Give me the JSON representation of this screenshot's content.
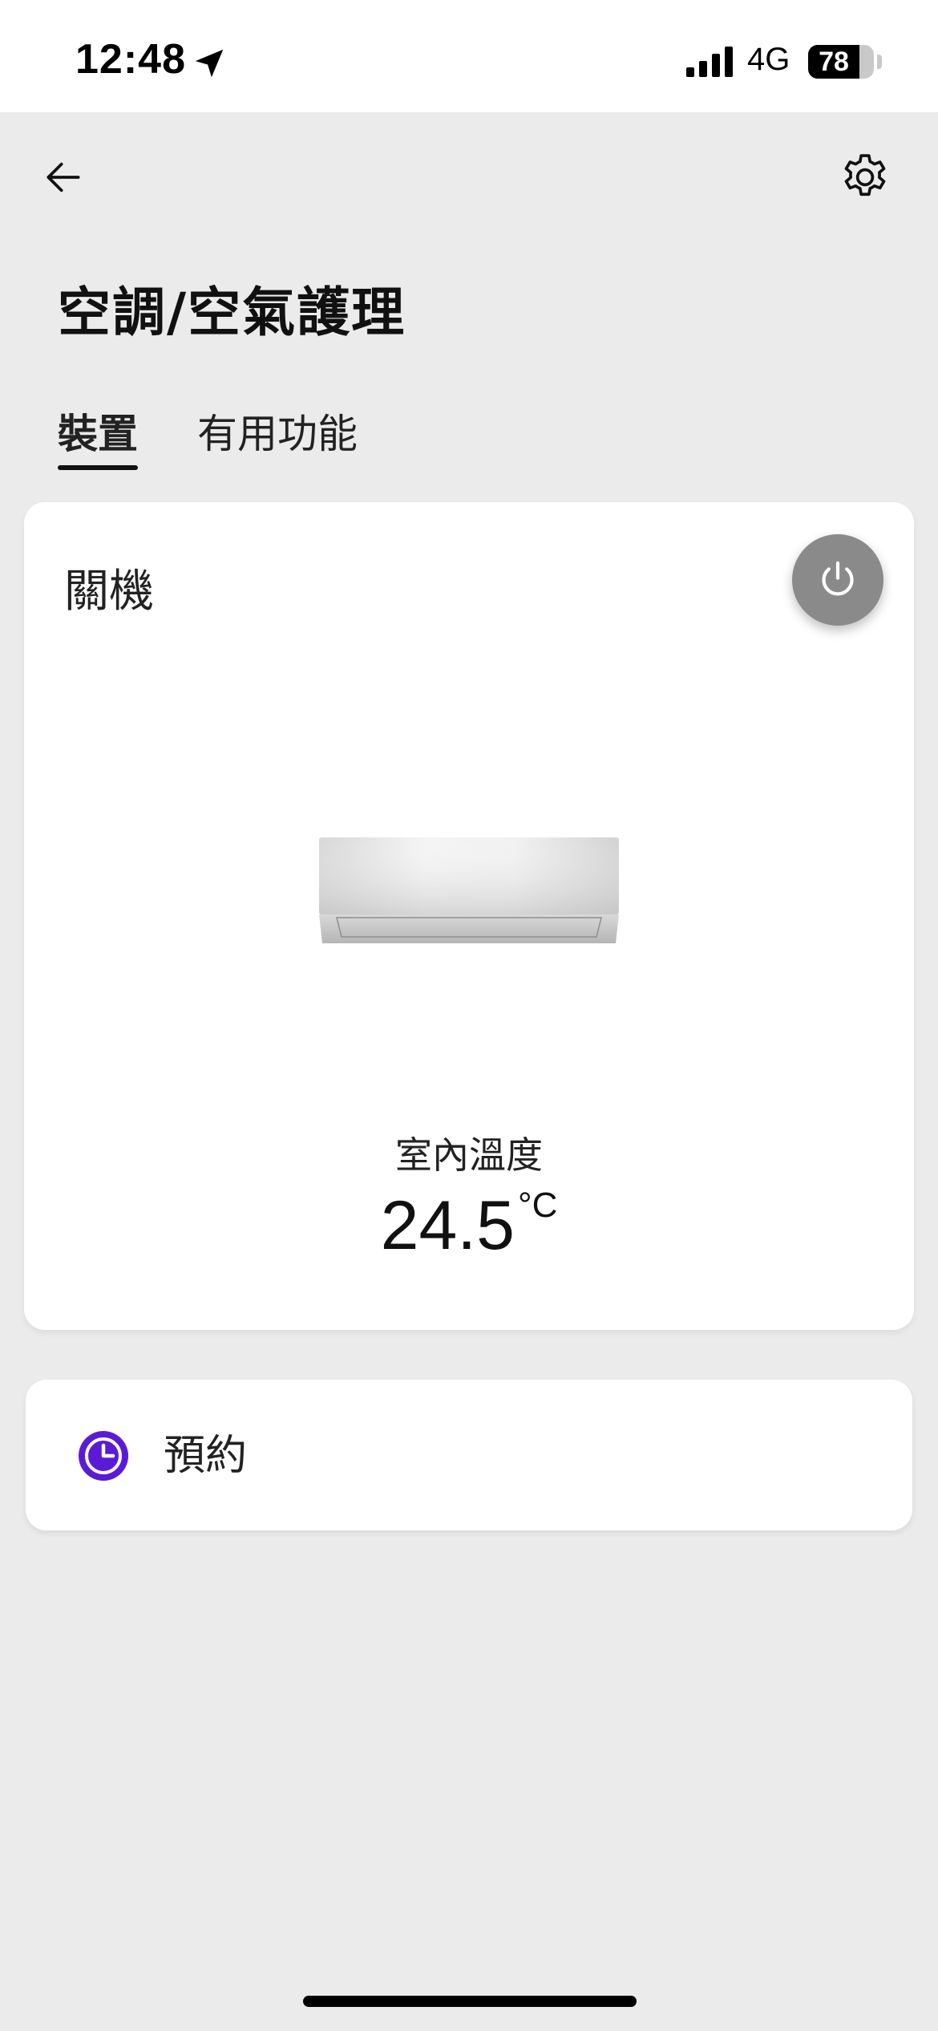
{
  "status_bar": {
    "time": "12:48",
    "network": "4G",
    "battery_level": "78",
    "battery_fraction": 0.78,
    "location_icon": "location-arrow-icon",
    "signal_icon": "cellular-signal-icon"
  },
  "header": {
    "back_icon": "arrow-left-icon",
    "settings_icon": "gear-icon",
    "title": "空調/空氣護理"
  },
  "tabs": [
    {
      "label": "裝置",
      "active": true
    },
    {
      "label": "有用功能",
      "active": false
    }
  ],
  "device_card": {
    "status": "關機",
    "power_icon": "power-icon",
    "power_button_color": "#8a8a8a",
    "image_icon": "air-conditioner-icon",
    "temperature_label": "室內溫度",
    "temperature_value": "24.5",
    "temperature_unit": "°C"
  },
  "schedule_card": {
    "icon": "clock-icon",
    "icon_color": "#5b1bd6",
    "label": "預約"
  }
}
